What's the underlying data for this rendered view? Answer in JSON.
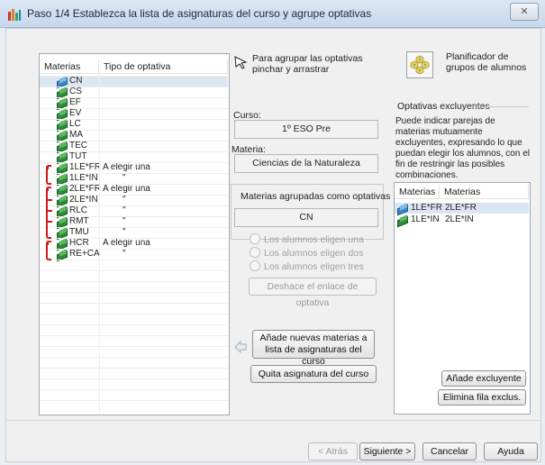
{
  "window": {
    "title": "Paso 1/4  Establezca la lista de asignaturas del curso y agrupe optativas",
    "close_icon": "close-icon"
  },
  "subjects_table": {
    "headers": [
      "Materias",
      "Tipo de optativa"
    ],
    "rows": [
      {
        "materia": "CN",
        "tipo": "",
        "icon": "book-blue-icon",
        "selected": true
      },
      {
        "materia": "CS",
        "tipo": "",
        "icon": "book-icon"
      },
      {
        "materia": "EF",
        "tipo": "",
        "icon": "book-icon"
      },
      {
        "materia": "EV",
        "tipo": "",
        "icon": "book-icon"
      },
      {
        "materia": "LC",
        "tipo": "",
        "icon": "book-icon"
      },
      {
        "materia": "MA",
        "tipo": "",
        "icon": "book-icon"
      },
      {
        "materia": "TEC",
        "tipo": "",
        "icon": "book-icon"
      },
      {
        "materia": "TUT",
        "tipo": "",
        "icon": "book-icon"
      },
      {
        "materia": "1LE*FR",
        "tipo": "A elegir una",
        "icon": "book-icon"
      },
      {
        "materia": "1LE*IN",
        "tipo": "\"",
        "icon": "book-icon"
      },
      {
        "materia": "2LE*FR",
        "tipo": "A elegir una",
        "icon": "book-icon"
      },
      {
        "materia": "2LE*IN",
        "tipo": "\"",
        "icon": "book-icon"
      },
      {
        "materia": "RLC",
        "tipo": "\"",
        "icon": "book-icon"
      },
      {
        "materia": "RMT",
        "tipo": "\"",
        "icon": "book-icon"
      },
      {
        "materia": "TMU",
        "tipo": "\"",
        "icon": "book-icon"
      },
      {
        "materia": "HCR",
        "tipo": "A elegir una",
        "icon": "book-icon"
      },
      {
        "materia": "RE+CA",
        "tipo": "\"",
        "icon": "book-icon"
      }
    ]
  },
  "middle": {
    "drag_hint": "Para agrupar las optativas pinchar y arrastrar",
    "drag_icon": "drag-cursor-icon",
    "curso_label": "Curso:",
    "curso_value": "1º ESO Pre",
    "materia_label": "Materia:",
    "materia_value": "Ciencias de la Naturaleza",
    "grouped_label": "Materias agrupadas como optativas",
    "grouped_value": "CN",
    "radios": [
      "Los alumnos eligen una",
      "Los alumnos eligen dos",
      "Los alumnos eligen tres"
    ],
    "unlink_button": "Deshace el enlace de optativa",
    "add_button": "Añade nuevas materias a lista de asignaturas del curso",
    "remove_button": "Quita asignatura del curso",
    "arrow_icon": "arrow-left-icon"
  },
  "right": {
    "planner_label": "Planificador de grupos de alumnos",
    "planner_icon": "group-planner-icon",
    "exclusive_title": "Optativas excluyentes",
    "exclusive_desc": "Puede indicar parejas de materias mutuamente excluyentes, expresando lo que puedan elegir los alumnos, con el fin de restringir las posibles combinaciones.",
    "table_headers": [
      "Materias",
      "Materias"
    ],
    "rows": [
      {
        "a": "1LE*FR",
        "b": "2LE*FR",
        "icon": "book-blue-icon"
      },
      {
        "a": "1LE*IN",
        "b": "2LE*IN",
        "icon": "book-icon"
      }
    ],
    "add_button": "Añade excluyente",
    "delete_button": "Elimina fila exclus."
  },
  "footer": {
    "back": "< Atrás",
    "next": "Siguiente >",
    "cancel": "Cancelar",
    "help": "Ayuda"
  },
  "colors": {
    "bracket": "#d01b1b",
    "selection": "#dce6f2"
  }
}
